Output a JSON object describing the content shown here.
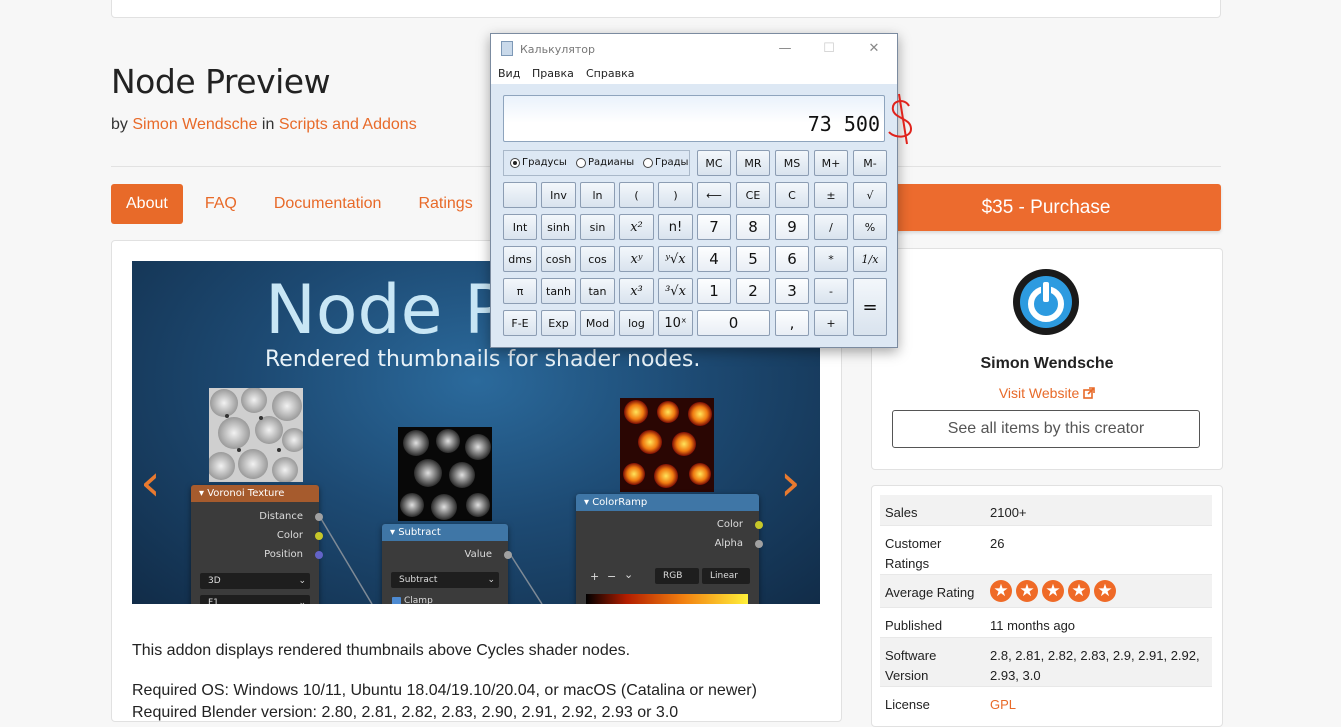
{
  "page": {
    "title": "Node Preview",
    "by_prefix": "by",
    "author": "Simon Wendsche",
    "in_word": "in",
    "category": "Scripts and Addons"
  },
  "tabs": [
    {
      "label": "About",
      "active": true
    },
    {
      "label": "FAQ"
    },
    {
      "label": "Documentation"
    },
    {
      "label": "Ratings"
    }
  ],
  "purchase": {
    "label": "$35 - Purchase"
  },
  "hero": {
    "title": "Node Pr",
    "subtitle": "Rendered thumbnails for shader nodes.",
    "prev_arrow": "‹",
    "next_arrow": "›",
    "nodes": {
      "voronoi": {
        "header": "▾ Voronoi Texture",
        "outputs": [
          "Distance",
          "Color",
          "Position"
        ],
        "sel1": "3D",
        "sel2": "F1"
      },
      "subtract": {
        "header": "▾ Subtract",
        "outputs": [
          "Value"
        ],
        "sel1": "Subtract",
        "clamp": "Clamp"
      },
      "colorramp": {
        "header": "▾ ColorRamp",
        "outputs": [
          "Color",
          "Alpha"
        ],
        "plus": "+",
        "minus": "−",
        "chev": "⌄",
        "mode": "RGB",
        "interp": "Linear"
      }
    },
    "colors": {
      "accent": "#e86a29",
      "voronoi_hdr": "#a65b2d",
      "subtract_hdr": "#3f76a6",
      "colorramp_hdr": "#3f76a6"
    }
  },
  "description": {
    "line1": "This addon displays rendered thumbnails above Cycles shader nodes.",
    "line2": "Required OS: Windows 10/11, Ubuntu 18.04/19.10/20.04, or macOS (Catalina or newer)",
    "line3": "Required Blender version: 2.80, 2.81, 2.82, 2.83, 2.90, 2.91, 2.92, 2.93 or 3.0"
  },
  "creator": {
    "name": "Simon Wendsche",
    "visit": "Visit Website",
    "see_all": "See all items by this creator"
  },
  "info": [
    {
      "key": "Sales",
      "value": "2100+"
    },
    {
      "key": "Customer Ratings",
      "value": "26"
    },
    {
      "key": "Average Rating",
      "stars": 5
    },
    {
      "key": "Published",
      "value": "11 months ago"
    },
    {
      "key": "Software Version",
      "value": "2.8, 2.81, 2.82, 2.83, 2.9, 2.91, 2.92, 2.93, 3.0"
    },
    {
      "key": "License",
      "value": "GPL"
    }
  ],
  "calculator": {
    "title": "Калькулятор",
    "window_buttons": {
      "minimize": "—",
      "maximize": "☐",
      "close": "✕"
    },
    "menu": [
      "Вид",
      "Правка",
      "Справка"
    ],
    "display": "73 500",
    "annotation": "$",
    "angle_units": [
      "Градусы",
      "Радианы",
      "Грады"
    ],
    "memory": [
      "MC",
      "MR",
      "MS",
      "M+",
      "M-"
    ],
    "row1": [
      "",
      "Inv",
      "ln",
      "(",
      ")",
      "⟵",
      "CE",
      "C",
      "±",
      "√"
    ],
    "row2": [
      "Int",
      "sinh",
      "sin",
      "x²",
      "n!",
      "7",
      "8",
      "9",
      "/",
      "%"
    ],
    "row3": [
      "dms",
      "cosh",
      "cos",
      "xʸ",
      "ʸ√x",
      "4",
      "5",
      "6",
      "*",
      "1/x"
    ],
    "row4": [
      "π",
      "tanh",
      "tan",
      "x³",
      "³√x",
      "1",
      "2",
      "3",
      "-",
      "="
    ],
    "row5": [
      "F-E",
      "Exp",
      "Mod",
      "log",
      "10ˣ",
      "0",
      ",",
      "+"
    ]
  }
}
